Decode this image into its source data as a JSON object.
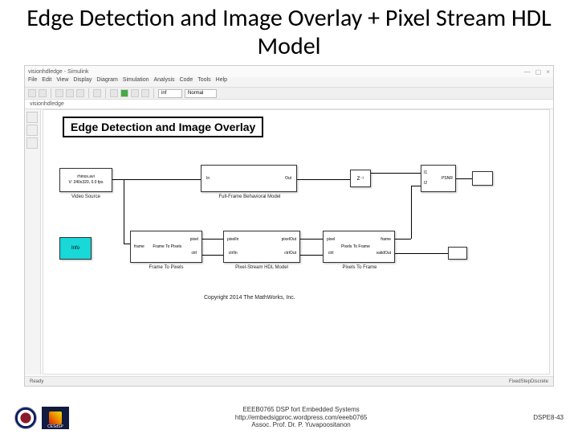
{
  "slide_title": "Edge Detection and Image Overlay + Pixel Stream HDL Model",
  "window": {
    "title": "visionhdledge - Simulink",
    "close": "×",
    "max": "▢",
    "min": "—"
  },
  "menu": [
    "File",
    "Edit",
    "View",
    "Display",
    "Diagram",
    "Simulation",
    "Analysis",
    "Code",
    "Tools",
    "Help"
  ],
  "toolbar_field": "Normal",
  "crumb": {
    "root": "visionhdledge"
  },
  "model": {
    "title": "Edge Detection and Image Overlay",
    "source": {
      "line1": "rhinos.avi",
      "line2": "V: 240x320, 0.0 fps",
      "label": "Video Source"
    },
    "ffb": {
      "in": "In",
      "out": "Out",
      "label": "Full-Frame Behavioral Model"
    },
    "delay": {
      "text": "Z⁻¹"
    },
    "psnr": {
      "ports": [
        "I1",
        "I2"
      ],
      "text": "PSNR"
    },
    "sink": "",
    "info": "Info",
    "f2p": {
      "p1": "frame",
      "p2": "pixel",
      "p3": "ctrl",
      "inlbl": "Frame To Pixels",
      "label": "Frame To Pixels"
    },
    "hdl": {
      "pin1": "pixelIn",
      "pin2": "ctrlIn",
      "pout1": "pixelOut",
      "pout2": "ctrlOut",
      "label": "Pixel-Stream HDL Model"
    },
    "p2f": {
      "p1": "pixel",
      "p2": "ctrl",
      "p3": "frame",
      "p4": "validOut",
      "label": "Pixels To Frame"
    },
    "copyright": "Copyright 2014 The MathWorks, Inc."
  },
  "status": {
    "left": "Ready",
    "right": "FixedStepDiscrete"
  },
  "footer": {
    "line1": "EEEB0765 DSP fort Embedded Systems",
    "line2": "http://embedsigproc.wordpress.com/eeeb0765",
    "line3": "Assoc. Prof. Dr. P. Yuvapoositanon",
    "page": "DSPE8-43",
    "logo2_text": "CESdSP"
  }
}
